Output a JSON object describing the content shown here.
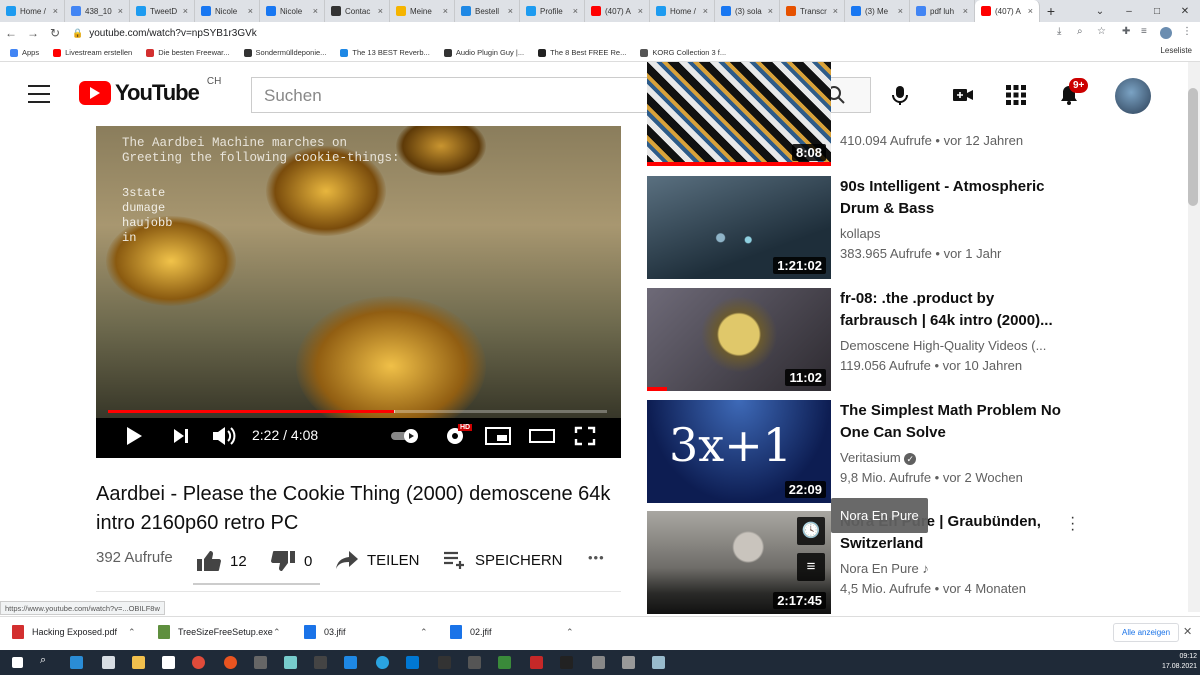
{
  "browser": {
    "tabs": [
      {
        "label": "Home /",
        "color": "#1d9bf0"
      },
      {
        "label": "438_10",
        "color": "#4285f4"
      },
      {
        "label": "TweetD",
        "color": "#1d9bf0"
      },
      {
        "label": "Nicole",
        "color": "#1877f2"
      },
      {
        "label": "Nicole",
        "color": "#1877f2"
      },
      {
        "label": "Contac",
        "color": "#333333"
      },
      {
        "label": "Meine",
        "color": "#f5b400"
      },
      {
        "label": "Bestell",
        "color": "#1e88e5"
      },
      {
        "label": "Profile",
        "color": "#1d9bf0"
      },
      {
        "label": "(407) A",
        "color": "#ff0000"
      },
      {
        "label": "Home /",
        "color": "#1d9bf0"
      },
      {
        "label": "(3) sola",
        "color": "#1877f2"
      },
      {
        "label": "Transcr",
        "color": "#e65100"
      },
      {
        "label": "(3) Me",
        "color": "#1877f2"
      },
      {
        "label": "pdf luh",
        "color": "#4285f4"
      },
      {
        "label": "(407) A",
        "color": "#ff0000"
      }
    ],
    "new_tab": "+",
    "window_controls": {
      "min": "–",
      "max": "□",
      "close": "✕"
    },
    "url": "youtube.com/watch?v=npSYB1r3GVk",
    "bookmarks": [
      {
        "label": "Apps",
        "color": "#4285f4"
      },
      {
        "label": "Livestream erstellen",
        "color": "#ff0000"
      },
      {
        "label": "Die besten Freewar...",
        "color": "#d32f2f"
      },
      {
        "label": "Sondermülldeponie...",
        "color": "#333333"
      },
      {
        "label": "The 13 BEST Reverb...",
        "color": "#1e88e5"
      },
      {
        "label": "Audio Plugin Guy |...",
        "color": "#333333"
      },
      {
        "label": "The 8 Best FREE Re...",
        "color": "#222222"
      },
      {
        "label": "KORG Collection 3 f...",
        "color": "#555555"
      }
    ],
    "leseliste": "Leseliste"
  },
  "youtube": {
    "logo_text": "YouTube",
    "region": "CH",
    "search_placeholder": "Suchen",
    "notification_count": "9+"
  },
  "player": {
    "overlay_text": "The Aardbei Machine marches on\nGreeting the following cookie-things:",
    "overlay_list": [
      "3state",
      "dumage",
      "haujobb",
      "in"
    ],
    "time": "2:22 / 4:08",
    "progress_fraction": 0.573,
    "buffered_fraction": 0.575,
    "hd_badge": "HD"
  },
  "video": {
    "title": "Aardbei - Please the Cookie Thing (2000) demoscene 64k intro 2160p60 retro PC",
    "views": "392 Aufrufe",
    "likes": "12",
    "dislikes": "0",
    "share_label": "TEILEN",
    "save_label": "SPEICHERN",
    "more": "•••"
  },
  "sidebar": {
    "items": [
      {
        "title": "",
        "channel": "",
        "meta": "410.094 Aufrufe • vor 12 Jahren",
        "duration": "8:08"
      },
      {
        "title": "90s Intelligent - Atmospheric Drum & Bass",
        "channel": "kollaps",
        "meta": "383.965 Aufrufe • vor 1 Jahr",
        "duration": "1:21:02"
      },
      {
        "title": "fr-08: .the .product by farbrausch | 64k intro (2000)...",
        "channel": "Demoscene High-Quality Videos (...",
        "meta": "119.056 Aufrufe • vor 10 Jahren",
        "duration": "11:02"
      },
      {
        "title": "The Simplest Math Problem No One Can Solve",
        "channel": "Veritasium",
        "meta": "9,8 Mio. Aufrufe • vor 2 Wochen",
        "duration": "22:09",
        "thumb_text": "3x+1"
      },
      {
        "title": "Nora En Pure | Graubünden, Switzerland",
        "channel": "Nora En Pure",
        "meta": "4,5 Mio. Aufrufe • vor 4 Monaten",
        "duration": "2:17:45"
      }
    ],
    "tooltip": "Nora En Pure"
  },
  "status_link": "https://www.youtube.com/watch?v=...OBILF8w",
  "downloads": {
    "items": [
      {
        "label": "Hacking Exposed.pdf",
        "color": "#d32f2f"
      },
      {
        "label": "TreeSizeFreeSetup.exe",
        "color": "#5f8f3e"
      },
      {
        "label": "03.jfif",
        "color": "#1a73e8"
      },
      {
        "label": "02.jfif",
        "color": "#1a73e8"
      }
    ],
    "show_all": "Alle anzeigen",
    "close": "✕"
  },
  "taskbar": {
    "time": "09:12",
    "date": "17.08.2021"
  }
}
